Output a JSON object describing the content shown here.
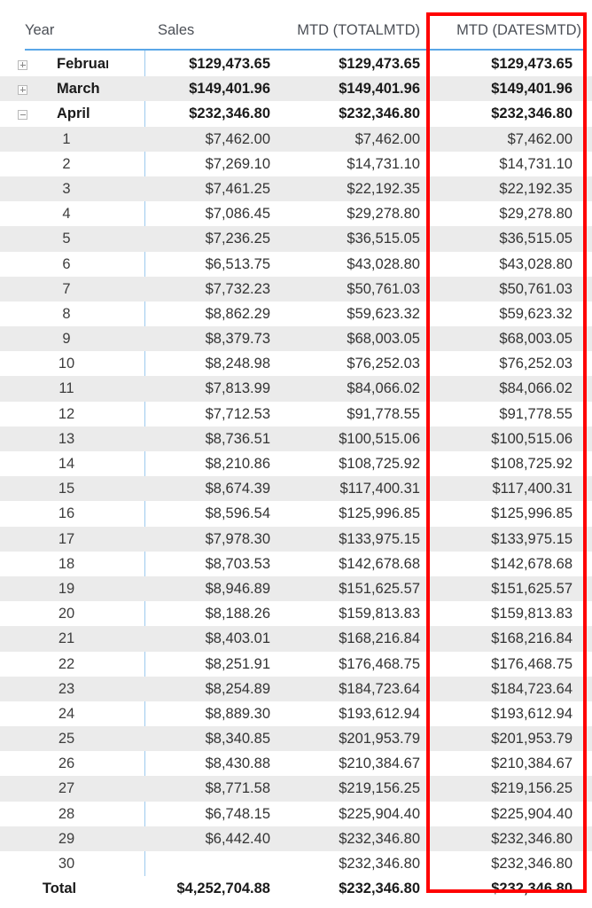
{
  "visual": {
    "type": "power-bi-matrix",
    "accent_line_color": "#5aa7e8",
    "stripe_color": "#ebebeb",
    "highlight_color": "#ff0000",
    "header_text_color": "#4b4f56"
  },
  "columns": {
    "year": "Year",
    "sales": "Sales",
    "mtd_totalmtd": "MTD (TOTALMTD)",
    "mtd_datesmtd": "MTD (DATESMTD)"
  },
  "icons": {
    "expand": "plus-square-icon",
    "collapse": "minus-square-icon"
  },
  "rows": [
    {
      "kind": "group",
      "expanded": false,
      "label": "February",
      "sales": "$129,473.65",
      "mtd_totalmtd": "$129,473.65",
      "mtd_datesmtd": "$129,473.65"
    },
    {
      "kind": "group",
      "expanded": false,
      "label": "March",
      "sales": "$149,401.96",
      "mtd_totalmtd": "$149,401.96",
      "mtd_datesmtd": "$149,401.96"
    },
    {
      "kind": "group",
      "expanded": true,
      "label": "April",
      "sales": "$232,346.80",
      "mtd_totalmtd": "$232,346.80",
      "mtd_datesmtd": "$232,346.80"
    },
    {
      "kind": "detail",
      "label": "1",
      "sales": "$7,462.00",
      "mtd_totalmtd": "$7,462.00",
      "mtd_datesmtd": "$7,462.00"
    },
    {
      "kind": "detail",
      "label": "2",
      "sales": "$7,269.10",
      "mtd_totalmtd": "$14,731.10",
      "mtd_datesmtd": "$14,731.10"
    },
    {
      "kind": "detail",
      "label": "3",
      "sales": "$7,461.25",
      "mtd_totalmtd": "$22,192.35",
      "mtd_datesmtd": "$22,192.35"
    },
    {
      "kind": "detail",
      "label": "4",
      "sales": "$7,086.45",
      "mtd_totalmtd": "$29,278.80",
      "mtd_datesmtd": "$29,278.80"
    },
    {
      "kind": "detail",
      "label": "5",
      "sales": "$7,236.25",
      "mtd_totalmtd": "$36,515.05",
      "mtd_datesmtd": "$36,515.05"
    },
    {
      "kind": "detail",
      "label": "6",
      "sales": "$6,513.75",
      "mtd_totalmtd": "$43,028.80",
      "mtd_datesmtd": "$43,028.80"
    },
    {
      "kind": "detail",
      "label": "7",
      "sales": "$7,732.23",
      "mtd_totalmtd": "$50,761.03",
      "mtd_datesmtd": "$50,761.03"
    },
    {
      "kind": "detail",
      "label": "8",
      "sales": "$8,862.29",
      "mtd_totalmtd": "$59,623.32",
      "mtd_datesmtd": "$59,623.32"
    },
    {
      "kind": "detail",
      "label": "9",
      "sales": "$8,379.73",
      "mtd_totalmtd": "$68,003.05",
      "mtd_datesmtd": "$68,003.05"
    },
    {
      "kind": "detail",
      "label": "10",
      "sales": "$8,248.98",
      "mtd_totalmtd": "$76,252.03",
      "mtd_datesmtd": "$76,252.03"
    },
    {
      "kind": "detail",
      "label": "11",
      "sales": "$7,813.99",
      "mtd_totalmtd": "$84,066.02",
      "mtd_datesmtd": "$84,066.02"
    },
    {
      "kind": "detail",
      "label": "12",
      "sales": "$7,712.53",
      "mtd_totalmtd": "$91,778.55",
      "mtd_datesmtd": "$91,778.55"
    },
    {
      "kind": "detail",
      "label": "13",
      "sales": "$8,736.51",
      "mtd_totalmtd": "$100,515.06",
      "mtd_datesmtd": "$100,515.06"
    },
    {
      "kind": "detail",
      "label": "14",
      "sales": "$8,210.86",
      "mtd_totalmtd": "$108,725.92",
      "mtd_datesmtd": "$108,725.92"
    },
    {
      "kind": "detail",
      "label": "15",
      "sales": "$8,674.39",
      "mtd_totalmtd": "$117,400.31",
      "mtd_datesmtd": "$117,400.31"
    },
    {
      "kind": "detail",
      "label": "16",
      "sales": "$8,596.54",
      "mtd_totalmtd": "$125,996.85",
      "mtd_datesmtd": "$125,996.85"
    },
    {
      "kind": "detail",
      "label": "17",
      "sales": "$7,978.30",
      "mtd_totalmtd": "$133,975.15",
      "mtd_datesmtd": "$133,975.15"
    },
    {
      "kind": "detail",
      "label": "18",
      "sales": "$8,703.53",
      "mtd_totalmtd": "$142,678.68",
      "mtd_datesmtd": "$142,678.68"
    },
    {
      "kind": "detail",
      "label": "19",
      "sales": "$8,946.89",
      "mtd_totalmtd": "$151,625.57",
      "mtd_datesmtd": "$151,625.57"
    },
    {
      "kind": "detail",
      "label": "20",
      "sales": "$8,188.26",
      "mtd_totalmtd": "$159,813.83",
      "mtd_datesmtd": "$159,813.83"
    },
    {
      "kind": "detail",
      "label": "21",
      "sales": "$8,403.01",
      "mtd_totalmtd": "$168,216.84",
      "mtd_datesmtd": "$168,216.84"
    },
    {
      "kind": "detail",
      "label": "22",
      "sales": "$8,251.91",
      "mtd_totalmtd": "$176,468.75",
      "mtd_datesmtd": "$176,468.75"
    },
    {
      "kind": "detail",
      "label": "23",
      "sales": "$8,254.89",
      "mtd_totalmtd": "$184,723.64",
      "mtd_datesmtd": "$184,723.64"
    },
    {
      "kind": "detail",
      "label": "24",
      "sales": "$8,889.30",
      "mtd_totalmtd": "$193,612.94",
      "mtd_datesmtd": "$193,612.94"
    },
    {
      "kind": "detail",
      "label": "25",
      "sales": "$8,340.85",
      "mtd_totalmtd": "$201,953.79",
      "mtd_datesmtd": "$201,953.79"
    },
    {
      "kind": "detail",
      "label": "26",
      "sales": "$8,430.88",
      "mtd_totalmtd": "$210,384.67",
      "mtd_datesmtd": "$210,384.67"
    },
    {
      "kind": "detail",
      "label": "27",
      "sales": "$8,771.58",
      "mtd_totalmtd": "$219,156.25",
      "mtd_datesmtd": "$219,156.25"
    },
    {
      "kind": "detail",
      "label": "28",
      "sales": "$6,748.15",
      "mtd_totalmtd": "$225,904.40",
      "mtd_datesmtd": "$225,904.40"
    },
    {
      "kind": "detail",
      "label": "29",
      "sales": "$6,442.40",
      "mtd_totalmtd": "$232,346.80",
      "mtd_datesmtd": "$232,346.80"
    },
    {
      "kind": "detail",
      "label": "30",
      "sales": "",
      "mtd_totalmtd": "$232,346.80",
      "mtd_datesmtd": "$232,346.80"
    },
    {
      "kind": "total",
      "label": "Total",
      "sales": "$4,252,704.88",
      "mtd_totalmtd": "$232,346.80",
      "mtd_datesmtd": "$232,346.80"
    }
  ]
}
